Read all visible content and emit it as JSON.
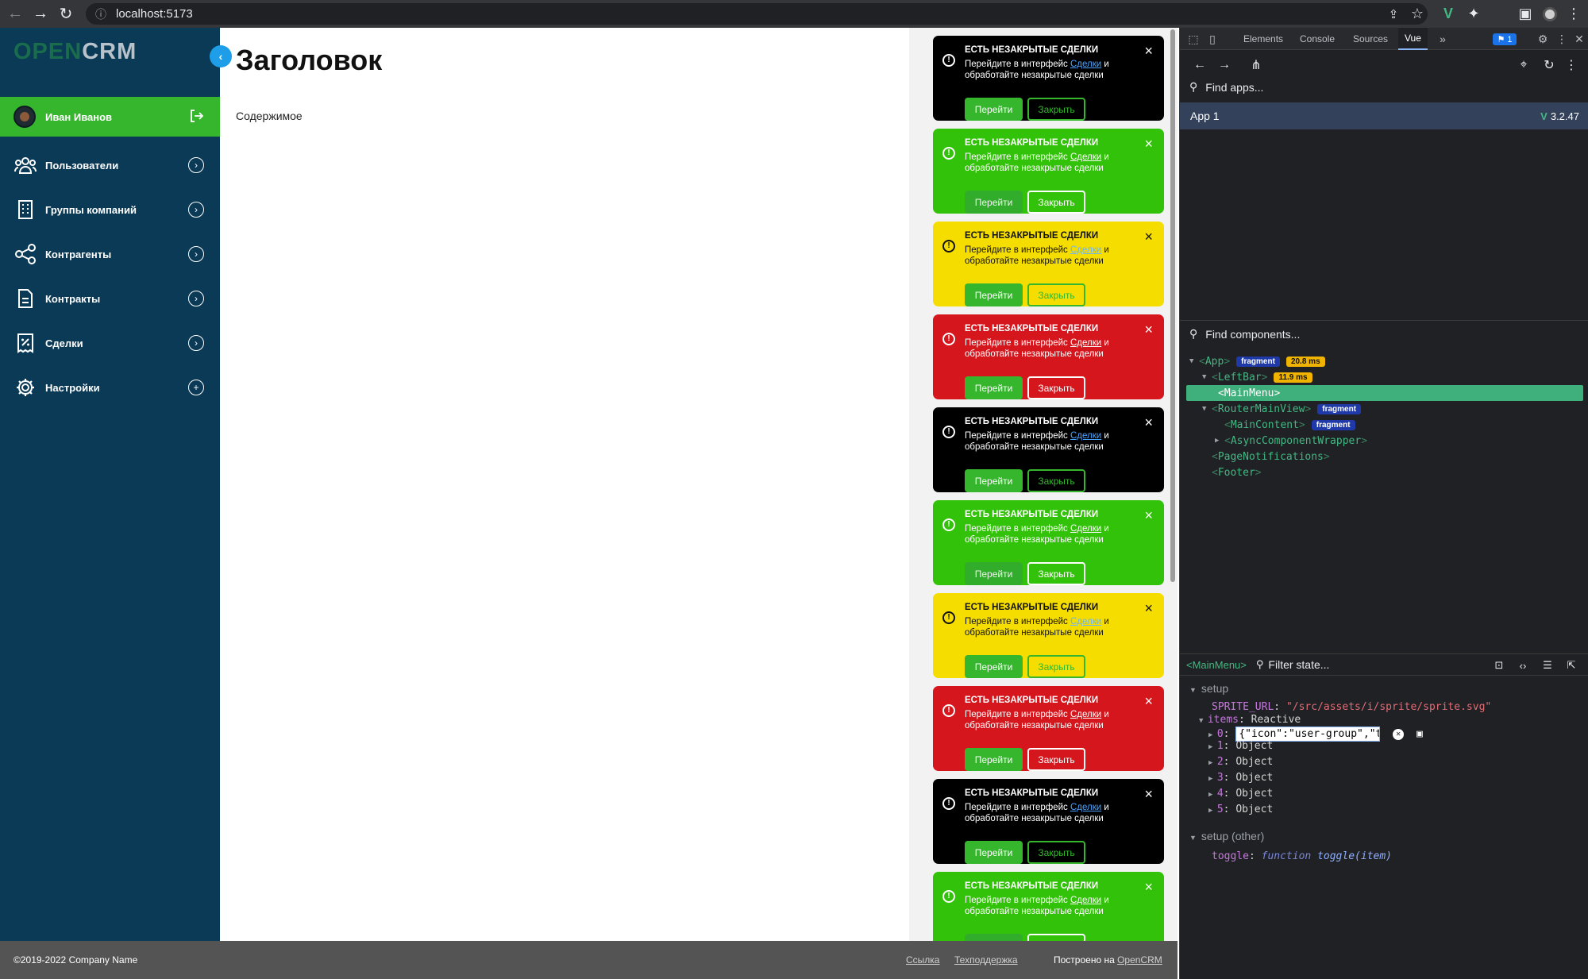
{
  "browser": {
    "url": "localhost:5173"
  },
  "app": {
    "logo_open": "OPEN",
    "logo_crm": "CRM",
    "user_name": "Иван Иванов",
    "menu": [
      {
        "label": "Пользователи",
        "icon": "users-icon",
        "action": "chevron-right"
      },
      {
        "label": "Группы компаний",
        "icon": "building-icon",
        "action": "chevron-right"
      },
      {
        "label": "Контрагенты",
        "icon": "share-nodes-icon",
        "action": "chevron-right"
      },
      {
        "label": "Контракты",
        "icon": "document-icon",
        "action": "chevron-right"
      },
      {
        "label": "Сделки",
        "icon": "receipt-percent-icon",
        "action": "chevron-right"
      },
      {
        "label": "Настройки",
        "icon": "gear-icon",
        "action": "plus"
      }
    ],
    "page_title": "Заголовок",
    "page_content": "Содержимое",
    "notification": {
      "title": "ЕСТЬ НЕЗАКРЫТЫЕ СДЕЛКИ",
      "text_before": "Перейдите в интерфейс ",
      "link": "Сделки",
      "text_after": " и обработайте незакрытые сделки",
      "go_label": "Перейти",
      "close_label": "Закрыть"
    },
    "notification_variants": [
      "black",
      "green",
      "yellow",
      "red",
      "black",
      "green",
      "yellow",
      "red",
      "black",
      "green"
    ],
    "colors": {
      "sidebar": "#0b3a57",
      "accent_green": "#35b62d",
      "toast_black": "#000000",
      "toast_green": "#33c20a",
      "toast_yellow": "#f6dd00",
      "toast_red": "#d6161d"
    },
    "footer": {
      "copyright": "©2019-2022 Company Name",
      "link1": "Ссылка",
      "link2": "Техподдержка",
      "built_prefix": "Построено на ",
      "built_link": "OpenCRM"
    }
  },
  "devtools": {
    "tabs": [
      "Elements",
      "Console",
      "Sources",
      "Vue"
    ],
    "active_tab": "Vue",
    "issues_count": "1",
    "find_apps": "Find apps...",
    "app_name": "App 1",
    "vue_version": "3.2.47",
    "find_components": "Find components...",
    "tree": {
      "app": "App",
      "app_badge": "fragment",
      "app_time": "20.8 ms",
      "leftbar": "LeftBar",
      "leftbar_time": "11.9 ms",
      "mainmenu": "MainMenu",
      "routermainview": "RouterMainView",
      "routermainview_badge": "fragment",
      "maincontent": "MainContent",
      "maincontent_badge": "fragment",
      "asyncwrapper": "AsyncComponentWrapper",
      "pagenotifications": "PageNotifications",
      "footer": "Footer"
    },
    "state": {
      "selected": "<MainMenu>",
      "filter": "Filter state...",
      "section_setup": "setup",
      "sprite_key": "SPRITE_URL",
      "sprite_val": "\"/src/assets/i/sprite/sprite.svg\"",
      "items_key": "items",
      "items_type": "Reactive",
      "item0_edit": "{\"icon\":\"user-group\",\"t",
      "items": [
        {
          "index": "1",
          "value": "Object"
        },
        {
          "index": "2",
          "value": "Object"
        },
        {
          "index": "3",
          "value": "Object"
        },
        {
          "index": "4",
          "value": "Object"
        },
        {
          "index": "5",
          "value": "Object"
        }
      ],
      "section_other": "setup (other)",
      "toggle_key": "toggle",
      "toggle_kw": "function",
      "toggle_sig": "toggle(item)"
    }
  }
}
